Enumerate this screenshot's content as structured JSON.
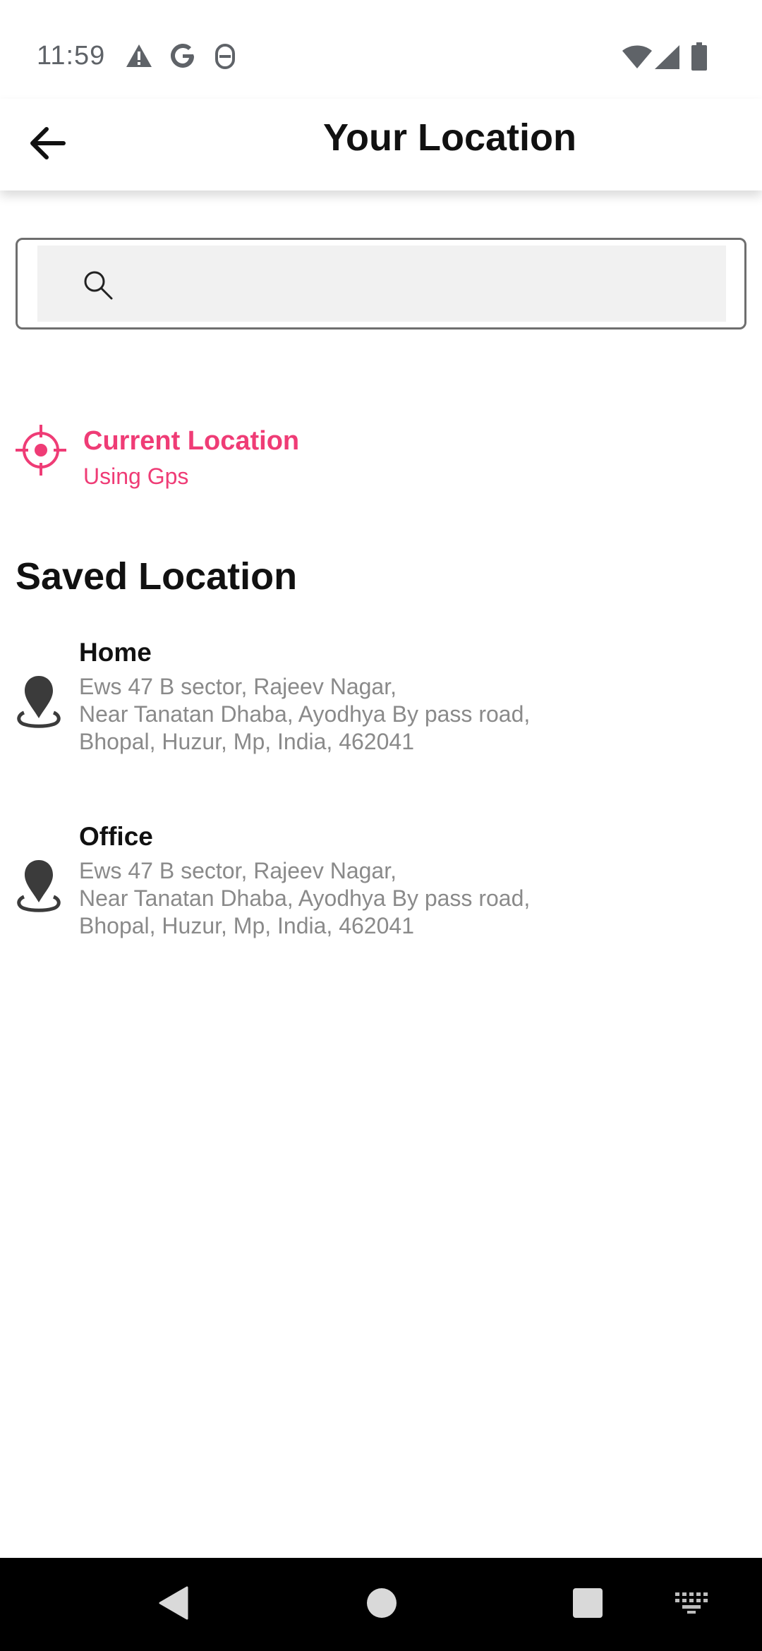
{
  "status_bar": {
    "time": "11:59",
    "icons": [
      "warning-icon",
      "google-icon",
      "privacy-icon",
      "wifi-icon",
      "signal-icon",
      "battery-icon"
    ]
  },
  "header": {
    "title": "Your Location",
    "back_icon": "arrow-left-icon"
  },
  "search": {
    "placeholder": "",
    "value": "",
    "icon": "search-icon"
  },
  "current_location": {
    "title": "Current Location",
    "subtitle": "Using Gps",
    "icon": "gps-target-icon",
    "accent_color": "#ef3c76"
  },
  "saved": {
    "heading": "Saved Location",
    "items": [
      {
        "name": "Home",
        "address_lines": [
          "Ews 47 B sector, Rajeev Nagar,",
          "Near Tanatan Dhaba, Ayodhya By pass road,",
          "Bhopal, Huzur, Mp, India, 462041"
        ],
        "icon": "map-pin-icon"
      },
      {
        "name": "Office",
        "address_lines": [
          "Ews 47 B sector, Rajeev Nagar,",
          "Near Tanatan Dhaba, Ayodhya By pass road,",
          "Bhopal, Huzur, Mp, India, 462041"
        ],
        "icon": "map-pin-icon"
      }
    ]
  },
  "nav_bar": {
    "buttons": [
      "back-triangle-icon",
      "home-circle-icon",
      "recents-square-icon",
      "keyboard-icon"
    ]
  }
}
